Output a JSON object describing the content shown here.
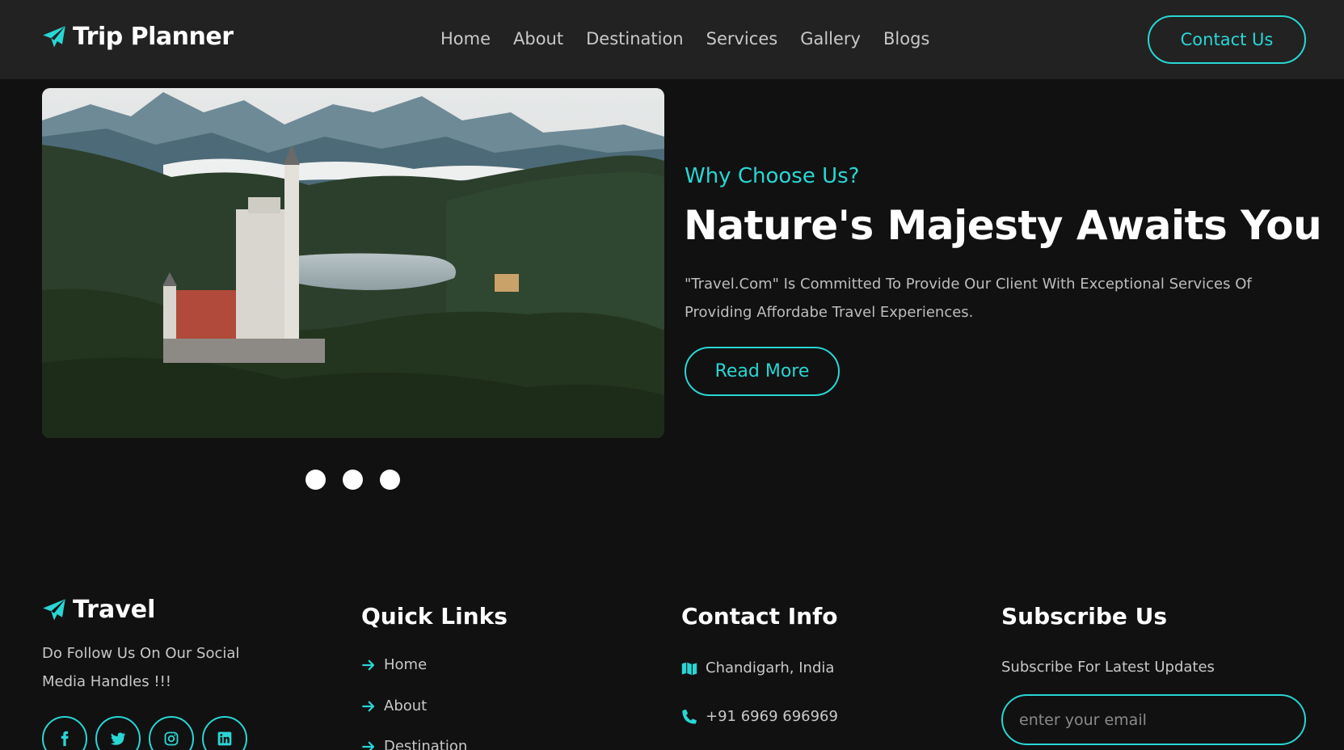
{
  "header": {
    "logo_text": "Trip Planner",
    "nav": [
      "Home",
      "About",
      "Destination",
      "Services",
      "Gallery",
      "Blogs"
    ],
    "contact_label": "Contact Us"
  },
  "hero": {
    "eyebrow": "Why Choose Us?",
    "headline": "Nature's Majesty Awaits You",
    "description": "\"Travel.Com\" Is Committed To Provide Our Client With Exceptional Services Of Providing Affordabe Travel Experiences.",
    "read_more_label": "Read More",
    "carousel_dots": 3
  },
  "footer": {
    "logo_text": "Travel",
    "follow_text": "Do Follow Us On Our Social Media Handles !!!",
    "socials": [
      "facebook-icon",
      "twitter-icon",
      "instagram-icon",
      "linkedin-icon"
    ],
    "quick_links_title": "Quick Links",
    "quick_links": [
      "Home",
      "About",
      "Destination"
    ],
    "contact_title": "Contact Info",
    "contact_location": "Chandigarh, India",
    "contact_phone": "+91 6969 696969",
    "subscribe_title": "Subscribe Us",
    "subscribe_text": "Subscribe For Latest Updates",
    "email_placeholder": "enter your email"
  },
  "colors": {
    "accent": "#29d6d4",
    "background": "#111111",
    "header_bg": "#222222"
  }
}
